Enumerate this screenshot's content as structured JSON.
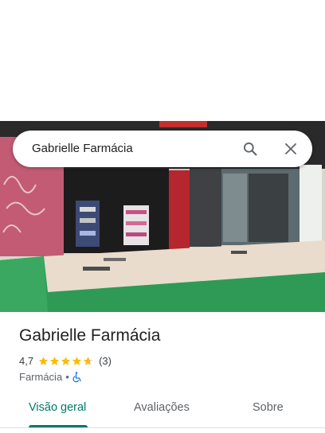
{
  "search": {
    "query": "Gabrielle Farmácia"
  },
  "place": {
    "name": "Gabrielle Farmácia",
    "rating": "4,7",
    "stars": 4.7,
    "review_count": "(3)",
    "category": "Farmácia",
    "separator": "•"
  },
  "tabs": [
    {
      "label": "Visão geral"
    },
    {
      "label": "Avaliações"
    },
    {
      "label": "Sobre"
    }
  ],
  "colors": {
    "accent": "#00796b",
    "star": "#fbbc04",
    "accessible": "#1a73e8"
  },
  "icons": [
    "search-icon",
    "close-icon",
    "star-icon",
    "wheelchair-icon"
  ]
}
